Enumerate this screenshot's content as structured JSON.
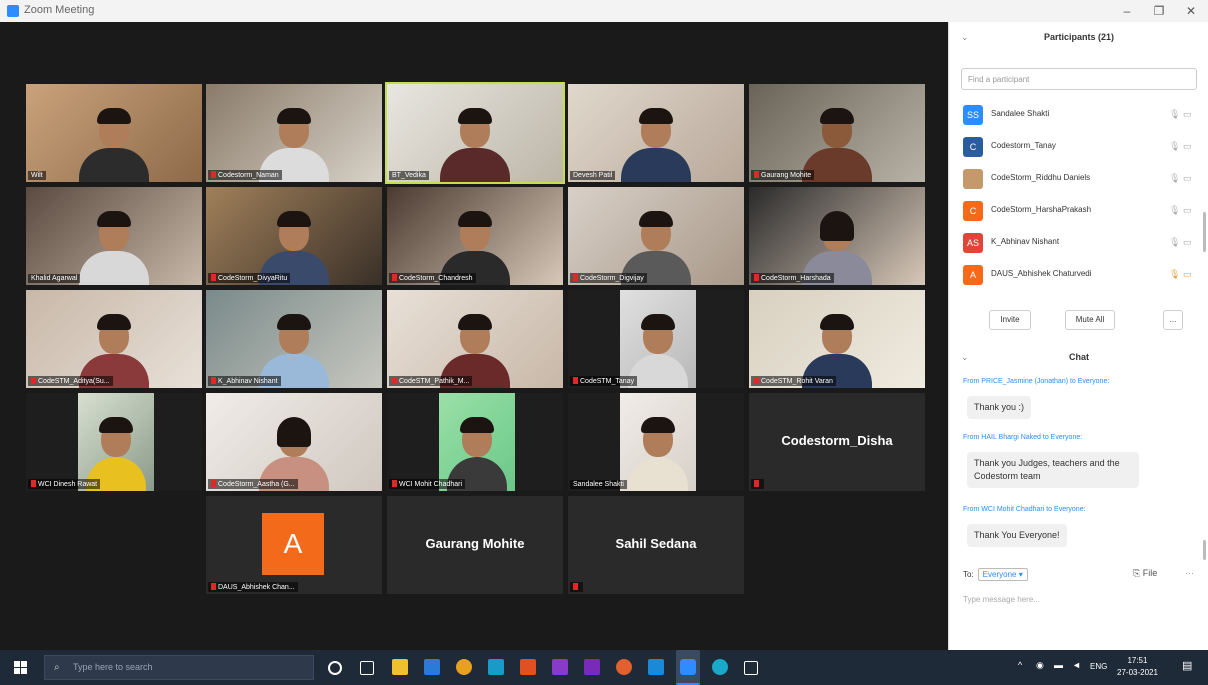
{
  "window": {
    "title": "Zoom Meeting",
    "minimize": "–",
    "maximize": "❐",
    "close": "✕"
  },
  "tiles": [
    {
      "name": "Wilt"
    },
    {
      "name": "Codestorm_Naman"
    },
    {
      "name": "BT_Vedika"
    },
    {
      "name": "Devesh Patil"
    },
    {
      "name": "Gaurang Mohite"
    },
    {
      "name": "Khalid Agarwal"
    },
    {
      "name": "CodeStorm_DivyaRitu"
    },
    {
      "name": "CodeStorm_Chandresh"
    },
    {
      "name": "CodeStorm_Digvijay"
    },
    {
      "name": "CodeStorm_Harshada"
    },
    {
      "name": "CodeSTM_Aditya(Su..."
    },
    {
      "name": "K_Abhinav Nishant"
    },
    {
      "name": "CodeSTM_Pathik_M..."
    },
    {
      "name": "CodeSTM_Tanay"
    },
    {
      "name": "CodeSTM_Rohit Varan"
    },
    {
      "name": "WCI Dinesh Rawat"
    },
    {
      "name": "CodeStorm_Aastha (G..."
    },
    {
      "name": "WCI Mohit Chadhari"
    },
    {
      "name": "Sandalee Shakti"
    },
    {
      "name": "Codestorm_Disha"
    },
    {
      "name": "DAUS_Abhishek Chan...",
      "initial": "A"
    },
    {
      "name": "Gaurang Mohite"
    },
    {
      "name": "Sahil Sedana"
    }
  ],
  "panel": {
    "collapse": "⌄",
    "title": "Participants (21)",
    "search_placeholder": "Find a participant",
    "participants": [
      {
        "initial": "SS",
        "name": "Sandalee Shakti",
        "color": "#2d8cff"
      },
      {
        "initial": "C",
        "name": "Codestorm_Tanay",
        "color": "#2b5d9c"
      },
      {
        "initial": "",
        "name": "CodeStorm_Riddhu Daniels",
        "color": "#c49a6c"
      },
      {
        "initial": "C",
        "name": "CodeStorm_HarshaPrakash",
        "color": "#f46a1b"
      },
      {
        "initial": "AS",
        "name": "K_Abhinav Nishant",
        "color": "#e0453a"
      },
      {
        "initial": "A",
        "name": "DAUS_Abhishek Chaturvedi",
        "color": "#f46a1b"
      }
    ],
    "invite": "Invite",
    "mute_all": "Mute All",
    "more": "...",
    "chat_collapse": "⌄",
    "chat_title": "Chat",
    "messages": [
      {
        "from": "From PRICE_Jasmine (Jonathan) to Everyone:",
        "text": "Thank you :)"
      },
      {
        "from": "From HAIL Bhargi Naked to Everyone:",
        "text": "Thank you Judges, teachers and the Codestorm team"
      },
      {
        "from": "From WCI Mohit Chadhari to Everyone:",
        "text": "Thank You Everyone!"
      }
    ],
    "to_label": "To:",
    "to_value": "Everyone ▾",
    "file": "File",
    "type_placeholder": "Type message here..."
  },
  "taskbar": {
    "search_placeholder": "Type here to search",
    "time": "17:51",
    "date": "27-03-2021",
    "lang": "ENG"
  },
  "colors": {
    "accent": "#2d8cff",
    "active_speaker": "#c3e04a",
    "avatar_orange": "#f46a1b",
    "mic_muted": "#e02828"
  }
}
